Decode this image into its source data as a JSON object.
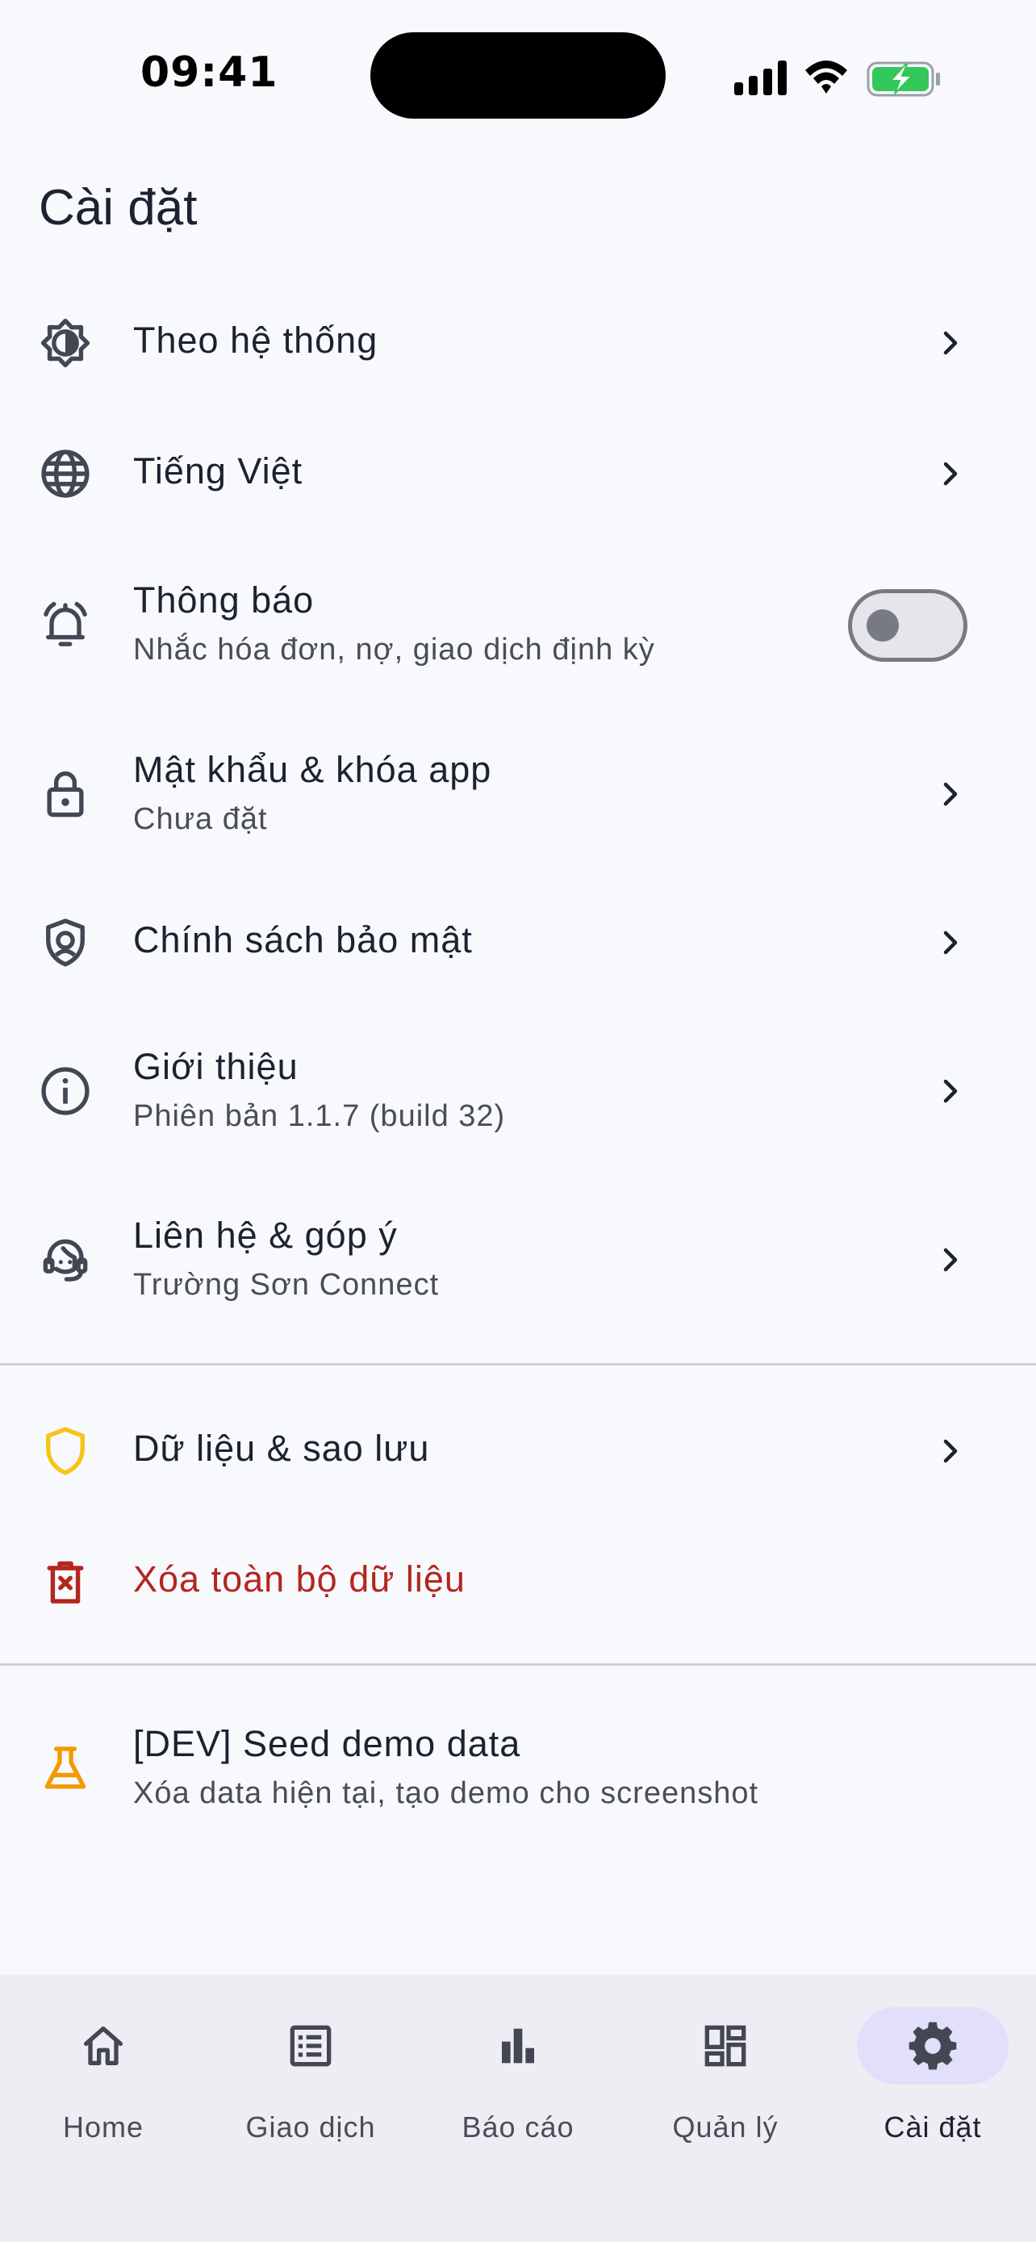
{
  "status_bar": {
    "time": "09:41"
  },
  "page_title": "Cài đặt",
  "settings": {
    "theme": {
      "title": "Theo hệ thống"
    },
    "language": {
      "title": "Tiếng Việt"
    },
    "notifications": {
      "title": "Thông báo",
      "subtitle": "Nhắc hóa đơn, nợ, giao dịch định kỳ",
      "enabled": false
    },
    "password": {
      "title": "Mật khẩu & khóa app",
      "subtitle": "Chưa đặt"
    },
    "privacy": {
      "title": "Chính sách bảo mật"
    },
    "about": {
      "title": "Giới thiệu",
      "subtitle": "Phiên bản 1.1.7 (build 32)"
    },
    "contact": {
      "title": "Liên hệ & góp ý",
      "subtitle": "Trường Sơn Connect"
    },
    "data_backup": {
      "title": "Dữ liệu & sao lưu"
    },
    "delete_all": {
      "title": "Xóa toàn bộ dữ liệu"
    },
    "dev_seed": {
      "title": "[DEV] Seed demo data",
      "subtitle": "Xóa data hiện tại, tạo demo cho screenshot"
    }
  },
  "bottom_nav": {
    "items": [
      {
        "label": "Home",
        "icon": "home-icon"
      },
      {
        "label": "Giao dịch",
        "icon": "list-icon"
      },
      {
        "label": "Báo cáo",
        "icon": "bar-chart-icon"
      },
      {
        "label": "Quản lý",
        "icon": "dashboard-icon"
      },
      {
        "label": "Cài đặt",
        "icon": "gear-icon"
      }
    ],
    "active_index": 4
  },
  "colors": {
    "background": "#f8f9fc",
    "text": "#1d2130",
    "danger": "#b3261e",
    "shield_yellow": "#f5c518",
    "flask_orange": "#f29900",
    "nav_background": "#efedf4",
    "nav_active_pill": "#e1dff9"
  }
}
